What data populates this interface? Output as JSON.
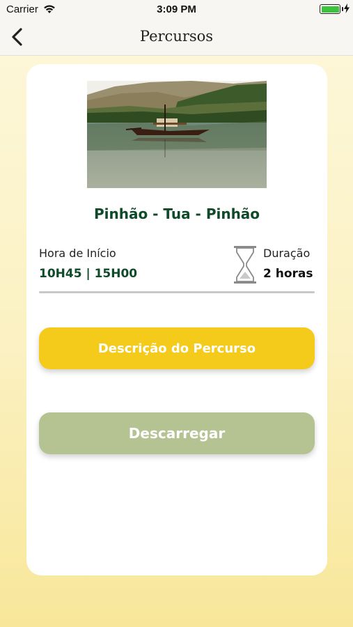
{
  "status_bar": {
    "carrier": "Carrier",
    "time": "3:09 PM",
    "battery_level": 1.0,
    "icons": [
      "wifi-icon",
      "battery-icon",
      "charging-bolt-icon"
    ]
  },
  "nav": {
    "title": "Percursos",
    "back_icon": "chevron-left-icon"
  },
  "route": {
    "photo": "river-boat-photo",
    "title": "Pinhão - Tua - Pinhão",
    "start_label": "Hora de Início",
    "start_value": "10H45 | 15H00",
    "duration_icon": "hourglass-icon",
    "duration_label": "Duração",
    "duration_value": "2 horas"
  },
  "buttons": {
    "description": "Descrição do Percurso",
    "download": "Descarregar"
  },
  "colors": {
    "accent_green": "#0f4a2a",
    "primary_yellow": "#f4cb1a",
    "disabled_green": "#b5c393"
  }
}
